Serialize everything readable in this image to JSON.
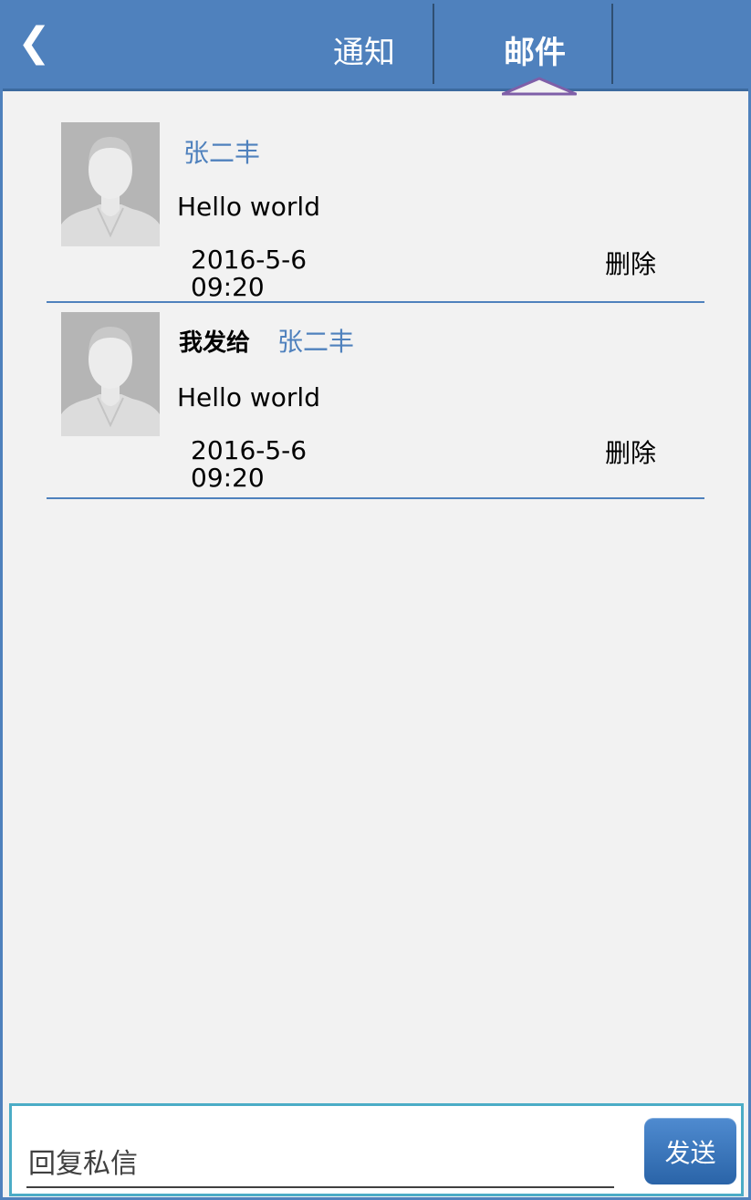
{
  "header": {
    "back_icon": "❮",
    "tabs": [
      {
        "label": "通知",
        "active": false
      },
      {
        "label": "邮件",
        "active": true
      }
    ]
  },
  "messages": [
    {
      "name": "张二丰",
      "sender_prefix": "",
      "body": "Hello world",
      "date": "2016-5-6",
      "time": "09:20",
      "delete_label": "删除"
    },
    {
      "name": "张二丰",
      "sender_prefix": "我发给",
      "body": "Hello world",
      "date": "2016-5-6",
      "time": "09:20",
      "delete_label": "删除"
    }
  ],
  "footer": {
    "reply_placeholder": "回复私信",
    "send_label": "发送"
  },
  "colors": {
    "accent": "#4f81bd",
    "footer_border": "#4bacc6",
    "background": "#f2f2f2"
  }
}
